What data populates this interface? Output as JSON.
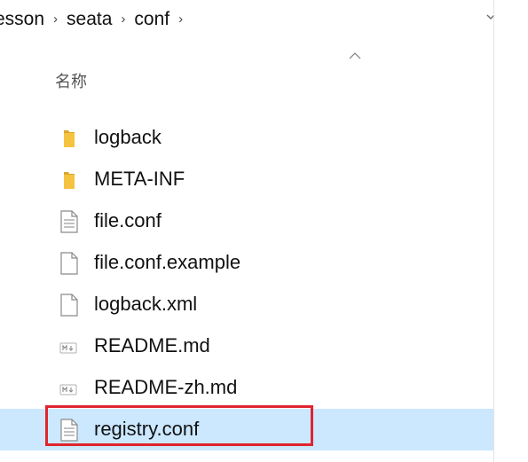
{
  "breadcrumb": {
    "items": [
      "esson",
      "seata",
      "conf"
    ],
    "separator": "›"
  },
  "column_header": {
    "name_label": "名称",
    "sort": "ascending"
  },
  "files": [
    {
      "name": "logback",
      "type": "folder",
      "icon": "folder-icon"
    },
    {
      "name": "META-INF",
      "type": "folder",
      "icon": "folder-icon"
    },
    {
      "name": "file.conf",
      "type": "text",
      "icon": "text-file-icon"
    },
    {
      "name": "file.conf.example",
      "type": "blank",
      "icon": "blank-file-icon"
    },
    {
      "name": "logback.xml",
      "type": "blank",
      "icon": "blank-file-icon"
    },
    {
      "name": "README.md",
      "type": "markdown",
      "icon": "markdown-file-icon"
    },
    {
      "name": "README-zh.md",
      "type": "markdown",
      "icon": "markdown-file-icon"
    },
    {
      "name": "registry.conf",
      "type": "text",
      "icon": "text-file-icon",
      "selected": true
    }
  ],
  "colors": {
    "selection": "#cce8ff",
    "highlight_border": "#e0242f",
    "folder": "#f5c342",
    "folder_dark": "#dca52a"
  }
}
